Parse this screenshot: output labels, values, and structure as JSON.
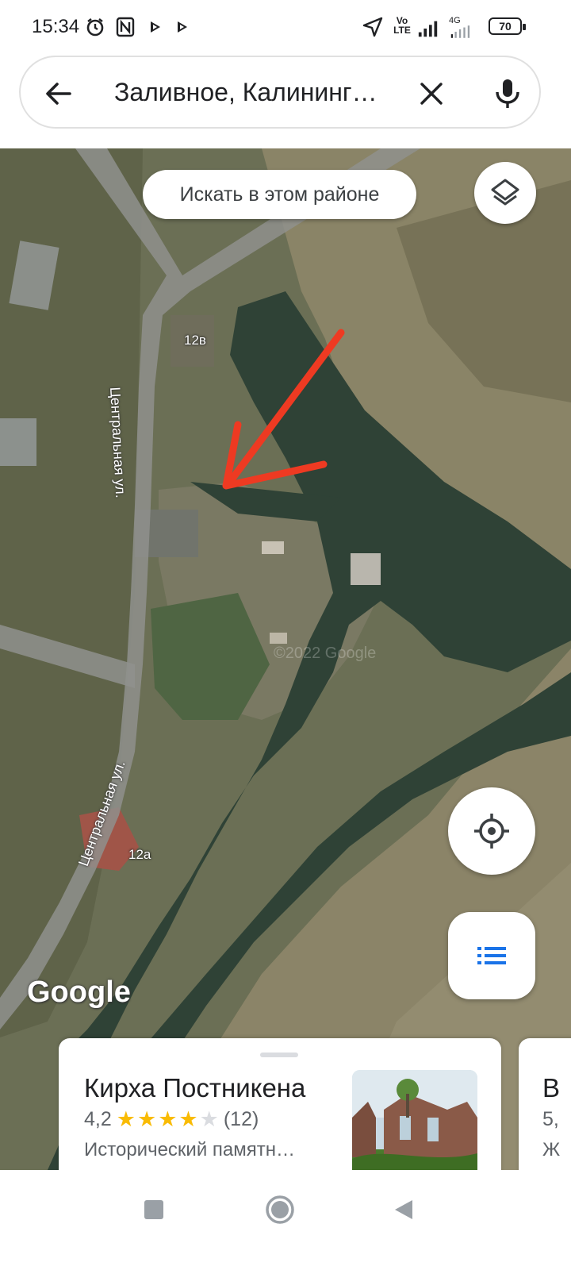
{
  "status_bar": {
    "time": "15:34",
    "network_label": "Vo LTE",
    "network_type": "4G",
    "battery": "70",
    "icons": [
      "alarm-icon",
      "nfc-icon",
      "play-icon",
      "play-icon",
      "location-arrow-icon",
      "signal-icon",
      "signal-icon"
    ]
  },
  "search": {
    "query": "Заливное, Калининг…",
    "icons": [
      "back-arrow-icon",
      "close-icon",
      "mic-icon"
    ]
  },
  "map": {
    "search_area_label": "Искать в этом районе",
    "google_logo": "Google",
    "watermark": "©2022 Google",
    "streets": [
      "Центральная ул.",
      "Центральная ул."
    ],
    "house_numbers": [
      "12в",
      "12а"
    ],
    "annotation": "red-arrow",
    "icons": [
      "layers-icon",
      "my-location-icon",
      "list-icon"
    ]
  },
  "place_card": {
    "name": "Кирха Постникена",
    "rating": "4,2",
    "rating_value": 4.2,
    "reviews": "(12)",
    "category": "Исторический памятн…",
    "accent_color": "#f9bb04"
  },
  "next_card": {
    "title": "В",
    "sub1": "5,",
    "sub2": "Ж"
  },
  "nav_bar": {
    "icons": [
      "recent-apps-icon",
      "home-icon",
      "back-icon"
    ]
  }
}
